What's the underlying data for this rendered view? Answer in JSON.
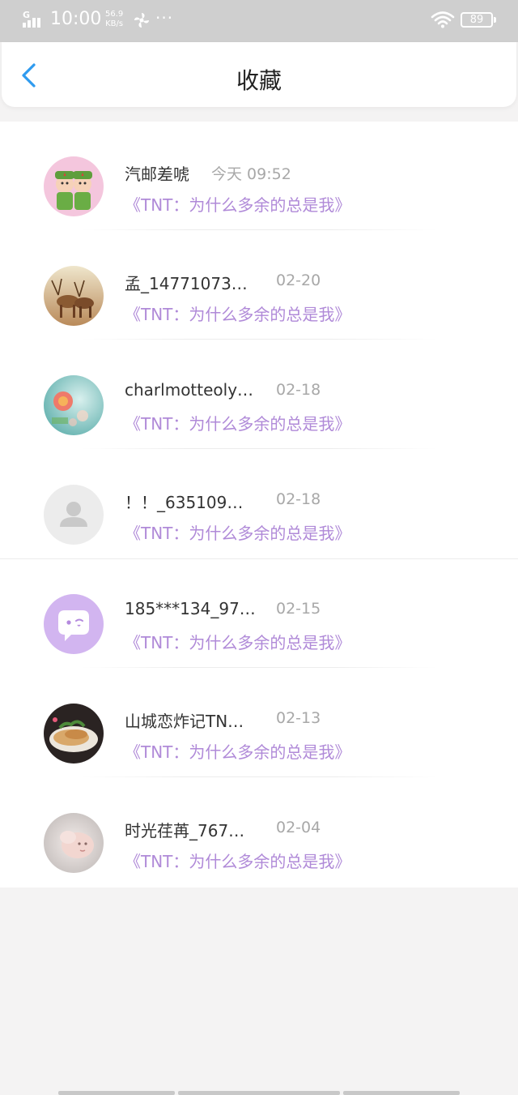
{
  "status_bar": {
    "network_label": "G",
    "time": "10:00",
    "speed_value": "56.9",
    "speed_unit": "KB/s",
    "more": "···",
    "battery": "89"
  },
  "header": {
    "back_icon": "chevron-left-icon",
    "title": "收藏"
  },
  "items": [
    {
      "name": "汽邮差唬",
      "time": "今天 09:52",
      "link": "《TNT：为什么多余的总是我》",
      "avatar": "cartoon-soldiers"
    },
    {
      "name": "孟_14771073…",
      "time": "02-20",
      "link": "《TNT：为什么多余的总是我》",
      "avatar": "deer-photo"
    },
    {
      "name": "charlmotteoly…",
      "time": "02-18",
      "link": "《TNT：为什么多余的总是我》",
      "avatar": "flower-photo"
    },
    {
      "name": "！！_635109…",
      "time": "02-18",
      "link": "《TNT：为什么多余的总是我》",
      "avatar": "default-user"
    },
    {
      "name": "185***134_97…",
      "time": "02-15",
      "link": "《TNT：为什么多余的总是我》",
      "avatar": "purple-chat-bubble"
    },
    {
      "name": "山城恋炸记TN…",
      "time": "02-13",
      "link": "《TNT：为什么多余的总是我》",
      "avatar": "food-photo"
    },
    {
      "name": "时光荏苒_767…",
      "time": "02-04",
      "link": "《TNT：为什么多余的总是我》",
      "avatar": "baby-photo"
    }
  ],
  "colors": {
    "accent_blue": "#2f9bef",
    "link_purple": "#b08ad8",
    "status_bar_gray": "#cfcfcf"
  }
}
